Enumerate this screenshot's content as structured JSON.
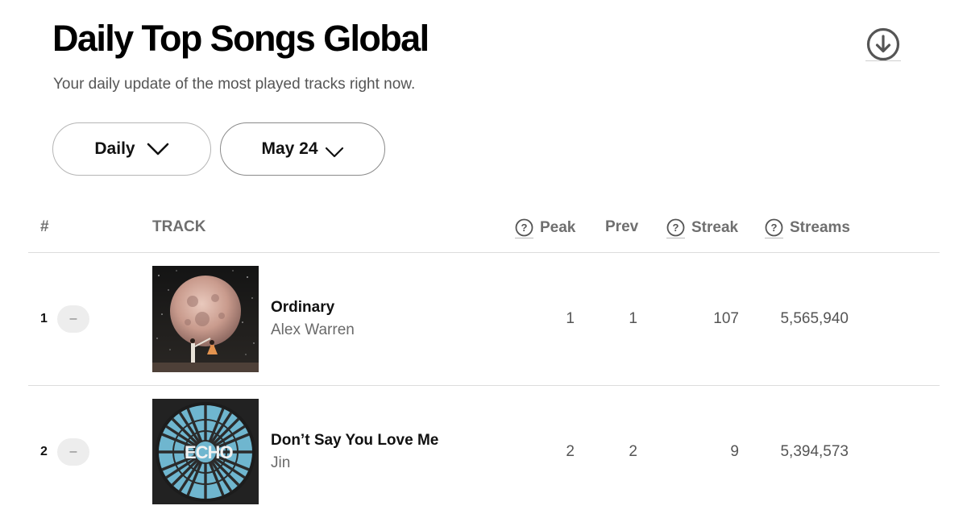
{
  "header": {
    "title": "Daily Top Songs Global",
    "subtitle": "Your daily update of the most played tracks right now.",
    "download_icon": "download-circle-icon"
  },
  "filters": {
    "period": {
      "label": "Daily",
      "icon": "chevron-down-icon"
    },
    "date": {
      "label": "May 24",
      "icon": "chevron-down-icon"
    }
  },
  "table": {
    "columns": {
      "rank": "#",
      "track": "TRACK",
      "peak": "Peak",
      "prev": "Prev",
      "streak": "Streak",
      "streams": "Streams"
    },
    "rows": [
      {
        "rank": "1",
        "change": "–",
        "title": "Ordinary",
        "artist": "Alex Warren",
        "peak": "1",
        "prev": "1",
        "streak": "107",
        "streams": "5,565,940"
      },
      {
        "rank": "2",
        "change": "–",
        "title": "Don’t Say You Love Me",
        "artist": "Jin",
        "peak": "2",
        "prev": "2",
        "streak": "9",
        "streams": "5,394,573"
      }
    ]
  },
  "colors": {
    "text_primary": "#111111",
    "text_secondary": "#6a6a6a",
    "divider": "#dcdcdc",
    "change_badge_bg": "#ededed"
  }
}
